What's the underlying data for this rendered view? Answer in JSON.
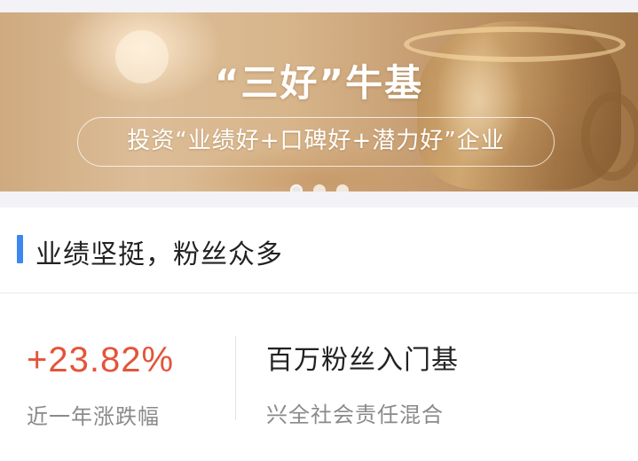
{
  "banner": {
    "title": "“三好”牛基",
    "subtitle": "投资“业绩好+口碑好+潜力好”企业",
    "dots": [
      {
        "active": true
      },
      {
        "active": false
      },
      {
        "active": false
      }
    ]
  },
  "section": {
    "title": "业绩坚挺，粉丝众多",
    "accent_color": "#3c87f0"
  },
  "fund": {
    "change_value": "+23.82%",
    "change_label": "近一年涨跌幅",
    "change_color": "#e3553a",
    "headline": "百万粉丝入门基",
    "name": "兴全社会责任混合"
  }
}
